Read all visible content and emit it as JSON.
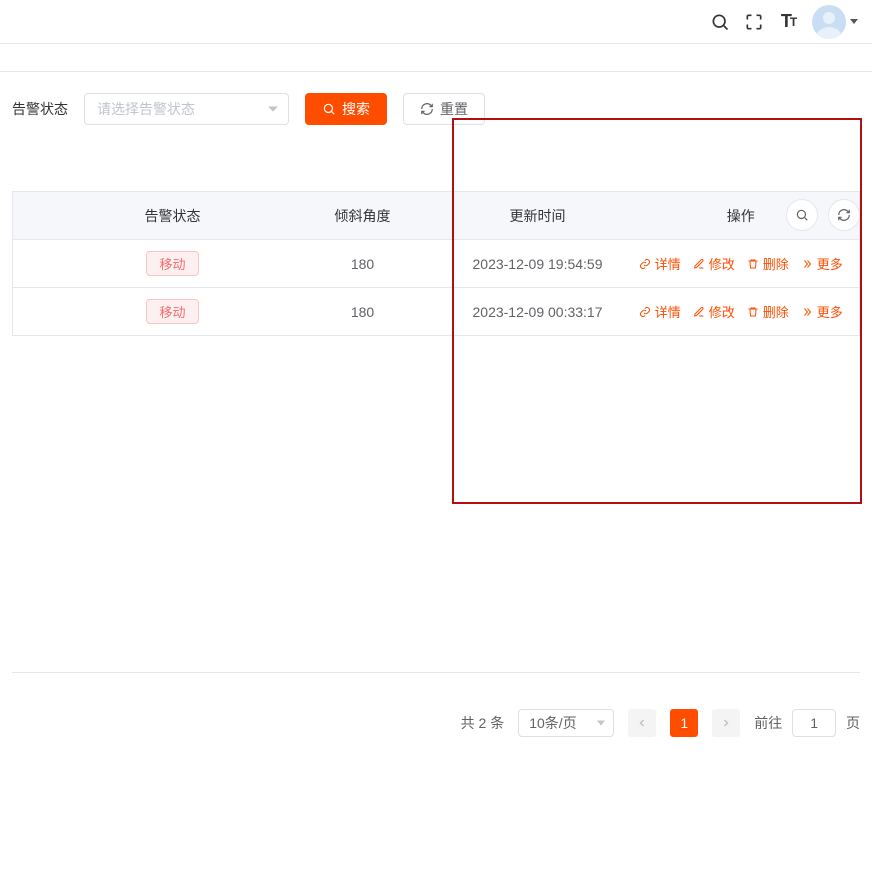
{
  "topbar": {
    "search_icon": "search-icon",
    "fullscreen_icon": "fullscreen-icon",
    "fontsize_icon": "fontsize-icon"
  },
  "filter": {
    "label": "告警状态",
    "select_placeholder": "请选择告警状态",
    "search_btn": "搜索",
    "reset_btn": "重置"
  },
  "columns": {
    "status": "告警状态",
    "angle": "倾斜角度",
    "update_time": "更新时间",
    "actions": "操作"
  },
  "rows": [
    {
      "status_tag": "移动",
      "angle": "180",
      "update_time": "2023-12-09 19:54:59"
    },
    {
      "status_tag": "移动",
      "angle": "180",
      "update_time": "2023-12-09 00:33:17"
    }
  ],
  "actions": {
    "detail": "详情",
    "edit": "修改",
    "delete": "删除",
    "more": "更多"
  },
  "pagination": {
    "total_text": "共 2 条",
    "page_size_label": "10条/页",
    "current_page": "1",
    "goto_prefix": "前往",
    "goto_value": "1",
    "goto_suffix": "页"
  }
}
